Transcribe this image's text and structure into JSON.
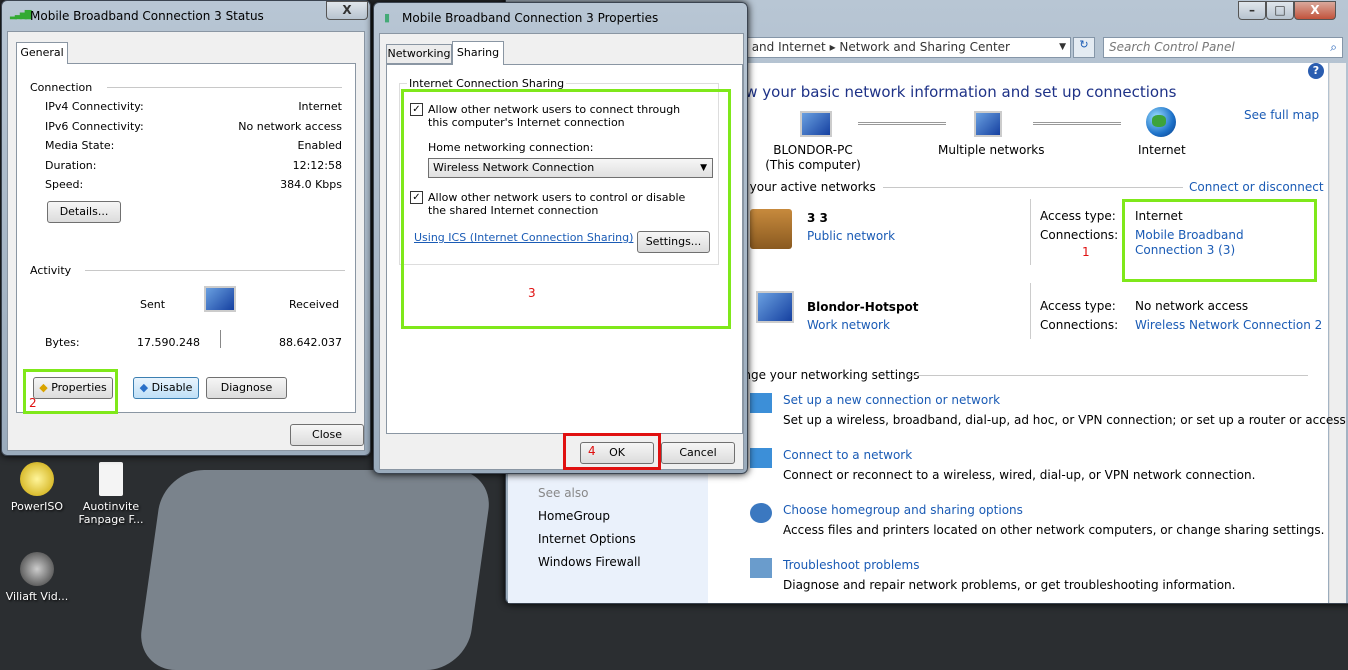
{
  "desktop": {
    "icons": [
      {
        "label": "PowerISO"
      },
      {
        "label": "Auotinvite Fanpage F..."
      },
      {
        "label": "Viliaft Vid..."
      }
    ]
  },
  "status_window": {
    "title": "Mobile Broadband Connection 3 Status",
    "tab": "General",
    "connection_heading": "Connection",
    "rows": [
      {
        "label": "IPv4 Connectivity:",
        "value": "Internet"
      },
      {
        "label": "IPv6 Connectivity:",
        "value": "No network access"
      },
      {
        "label": "Media State:",
        "value": "Enabled"
      },
      {
        "label": "Duration:",
        "value": "12:12:58"
      },
      {
        "label": "Speed:",
        "value": "384.0 Kbps"
      }
    ],
    "details_button": "Details...",
    "activity_heading": "Activity",
    "sent_label": "Sent",
    "received_label": "Received",
    "bytes_label": "Bytes:",
    "bytes_sent": "17.590.248",
    "bytes_received": "88.642.037",
    "properties_button": "Properties",
    "disable_button": "Disable",
    "diagnose_button": "Diagnose",
    "close_button": "Close",
    "annotation": "2"
  },
  "properties_window": {
    "title": "Mobile Broadband Connection 3 Properties",
    "tabs": [
      {
        "label": "Networking"
      },
      {
        "label": "Sharing"
      }
    ],
    "ics_group": "Internet Connection Sharing",
    "allow_connect": {
      "label": "Allow other network users to connect through this computer's Internet connection",
      "checked": true
    },
    "home_conn_label": "Home networking connection:",
    "home_conn_value": "Wireless Network Connection",
    "allow_control": {
      "label": "Allow other network users to control or disable the shared Internet connection",
      "checked": true
    },
    "ics_link": "Using ICS (Internet Connection Sharing)",
    "settings_button": "Settings...",
    "annotation_3": "3",
    "annotation_4": "4",
    "ok_button": "OK",
    "cancel_button": "Cancel"
  },
  "control_panel": {
    "breadcrumb": [
      "rk and Internet",
      "Network and Sharing Center"
    ],
    "search_placeholder": "Search Control Panel",
    "heading": "ew your basic network information and set up connections",
    "map": {
      "computer": "BLONDOR-PC",
      "computer_sub": "(This computer)",
      "middle": "Multiple networks",
      "end": "Internet",
      "see_full_map": "See full map"
    },
    "active_heading": "w your active networks",
    "connect_or_disconnect": "Connect or disconnect",
    "networks": [
      {
        "name": "3 3",
        "type": "Public network",
        "access_label": "Access type:",
        "access": "Internet",
        "conn_label": "Connections:",
        "connection": "Mobile Broadband Connection 3 (3)",
        "annotation": "1"
      },
      {
        "name": "Blondor-Hotspot",
        "type": "Work network",
        "access_label": "Access type:",
        "access": "No network access",
        "conn_label": "Connections:",
        "connection": "Wireless Network Connection 2"
      }
    ],
    "settings_heading": "ange your networking settings",
    "tasks": [
      {
        "link": "Set up a new connection or network",
        "desc": "Set up a wireless, broadband, dial-up, ad hoc, or VPN connection; or set up a router or access point."
      },
      {
        "link": "Connect to a network",
        "desc": "Connect or reconnect to a wireless, wired, dial-up, or VPN network connection."
      },
      {
        "link": "Choose homegroup and sharing options",
        "desc": "Access files and printers located on other network computers, or change sharing settings."
      },
      {
        "link": "Troubleshoot problems",
        "desc": "Diagnose and repair network problems, or get troubleshooting information."
      }
    ],
    "see_also": {
      "heading": "See also",
      "items": [
        "HomeGroup",
        "Internet Options",
        "Windows Firewall"
      ]
    }
  }
}
